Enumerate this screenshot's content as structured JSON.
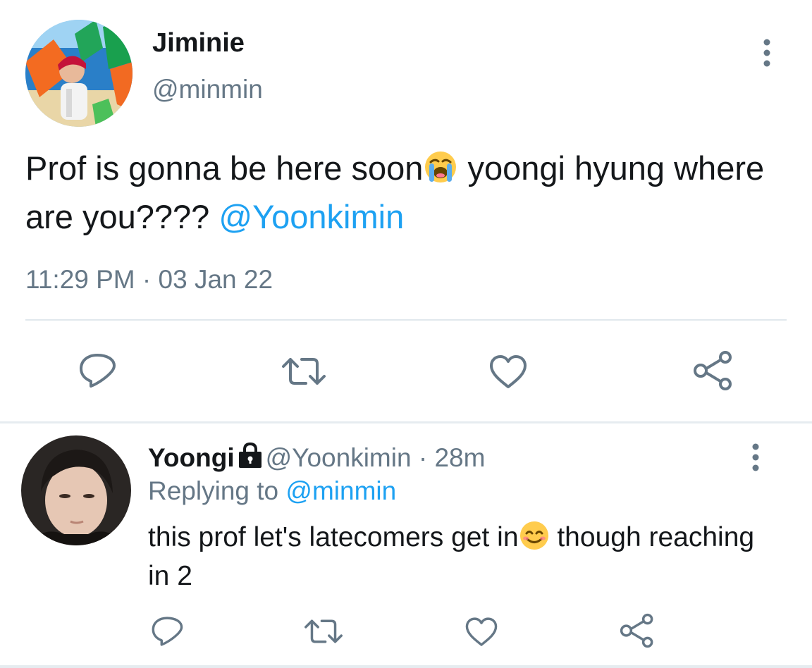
{
  "main_tweet": {
    "display_name": "Jiminie",
    "handle": "@minmin",
    "text_part1": "Prof is gonna be here soon",
    "emoji": "loudly-crying-face",
    "text_part2": " yoongi hyung where are you???? ",
    "mention": "@Yoonkimin",
    "time": "11:29 PM",
    "separator": "·",
    "date": "03 Jan 22",
    "actions": [
      "reply-icon",
      "retweet-icon",
      "like-icon",
      "share-icon"
    ]
  },
  "reply_tweet": {
    "display_name": "Yoongi",
    "protected_icon": "lock-icon",
    "handle": "@Yoonkimin",
    "separator": "·",
    "time_ago": "28m",
    "replying_prefix": "Replying to ",
    "replying_to": "@minmin",
    "text_part1": "this prof let's latecomers get in",
    "emoji": "smiling-face-with-smiling-eyes",
    "text_part2": " though reaching in 2",
    "actions": [
      "reply-icon",
      "retweet-icon",
      "like-icon",
      "share-icon"
    ]
  },
  "colors": {
    "text_primary": "#14171a",
    "text_secondary": "#657786",
    "link": "#1da1f2",
    "icon": "#657786",
    "divider": "#e1e8ed"
  }
}
